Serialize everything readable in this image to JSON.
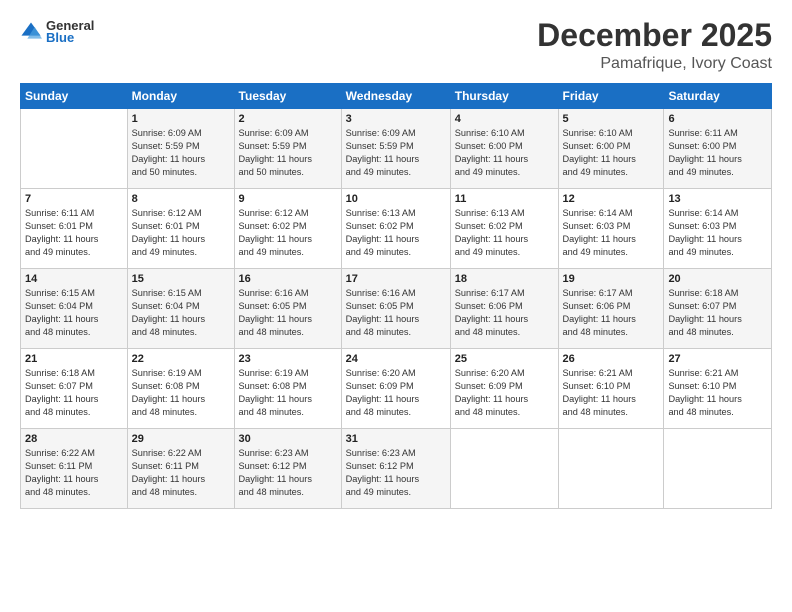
{
  "logo": {
    "text_general": "General",
    "text_blue": "Blue"
  },
  "header": {
    "month": "December 2025",
    "location": "Pamafrique, Ivory Coast"
  },
  "weekdays": [
    "Sunday",
    "Monday",
    "Tuesday",
    "Wednesday",
    "Thursday",
    "Friday",
    "Saturday"
  ],
  "weeks": [
    [
      {
        "day": "",
        "info": ""
      },
      {
        "day": "1",
        "info": "Sunrise: 6:09 AM\nSunset: 5:59 PM\nDaylight: 11 hours\nand 50 minutes."
      },
      {
        "day": "2",
        "info": "Sunrise: 6:09 AM\nSunset: 5:59 PM\nDaylight: 11 hours\nand 50 minutes."
      },
      {
        "day": "3",
        "info": "Sunrise: 6:09 AM\nSunset: 5:59 PM\nDaylight: 11 hours\nand 49 minutes."
      },
      {
        "day": "4",
        "info": "Sunrise: 6:10 AM\nSunset: 6:00 PM\nDaylight: 11 hours\nand 49 minutes."
      },
      {
        "day": "5",
        "info": "Sunrise: 6:10 AM\nSunset: 6:00 PM\nDaylight: 11 hours\nand 49 minutes."
      },
      {
        "day": "6",
        "info": "Sunrise: 6:11 AM\nSunset: 6:00 PM\nDaylight: 11 hours\nand 49 minutes."
      }
    ],
    [
      {
        "day": "7",
        "info": "Sunrise: 6:11 AM\nSunset: 6:01 PM\nDaylight: 11 hours\nand 49 minutes."
      },
      {
        "day": "8",
        "info": "Sunrise: 6:12 AM\nSunset: 6:01 PM\nDaylight: 11 hours\nand 49 minutes."
      },
      {
        "day": "9",
        "info": "Sunrise: 6:12 AM\nSunset: 6:02 PM\nDaylight: 11 hours\nand 49 minutes."
      },
      {
        "day": "10",
        "info": "Sunrise: 6:13 AM\nSunset: 6:02 PM\nDaylight: 11 hours\nand 49 minutes."
      },
      {
        "day": "11",
        "info": "Sunrise: 6:13 AM\nSunset: 6:02 PM\nDaylight: 11 hours\nand 49 minutes."
      },
      {
        "day": "12",
        "info": "Sunrise: 6:14 AM\nSunset: 6:03 PM\nDaylight: 11 hours\nand 49 minutes."
      },
      {
        "day": "13",
        "info": "Sunrise: 6:14 AM\nSunset: 6:03 PM\nDaylight: 11 hours\nand 49 minutes."
      }
    ],
    [
      {
        "day": "14",
        "info": "Sunrise: 6:15 AM\nSunset: 6:04 PM\nDaylight: 11 hours\nand 48 minutes."
      },
      {
        "day": "15",
        "info": "Sunrise: 6:15 AM\nSunset: 6:04 PM\nDaylight: 11 hours\nand 48 minutes."
      },
      {
        "day": "16",
        "info": "Sunrise: 6:16 AM\nSunset: 6:05 PM\nDaylight: 11 hours\nand 48 minutes."
      },
      {
        "day": "17",
        "info": "Sunrise: 6:16 AM\nSunset: 6:05 PM\nDaylight: 11 hours\nand 48 minutes."
      },
      {
        "day": "18",
        "info": "Sunrise: 6:17 AM\nSunset: 6:06 PM\nDaylight: 11 hours\nand 48 minutes."
      },
      {
        "day": "19",
        "info": "Sunrise: 6:17 AM\nSunset: 6:06 PM\nDaylight: 11 hours\nand 48 minutes."
      },
      {
        "day": "20",
        "info": "Sunrise: 6:18 AM\nSunset: 6:07 PM\nDaylight: 11 hours\nand 48 minutes."
      }
    ],
    [
      {
        "day": "21",
        "info": "Sunrise: 6:18 AM\nSunset: 6:07 PM\nDaylight: 11 hours\nand 48 minutes."
      },
      {
        "day": "22",
        "info": "Sunrise: 6:19 AM\nSunset: 6:08 PM\nDaylight: 11 hours\nand 48 minutes."
      },
      {
        "day": "23",
        "info": "Sunrise: 6:19 AM\nSunset: 6:08 PM\nDaylight: 11 hours\nand 48 minutes."
      },
      {
        "day": "24",
        "info": "Sunrise: 6:20 AM\nSunset: 6:09 PM\nDaylight: 11 hours\nand 48 minutes."
      },
      {
        "day": "25",
        "info": "Sunrise: 6:20 AM\nSunset: 6:09 PM\nDaylight: 11 hours\nand 48 minutes."
      },
      {
        "day": "26",
        "info": "Sunrise: 6:21 AM\nSunset: 6:10 PM\nDaylight: 11 hours\nand 48 minutes."
      },
      {
        "day": "27",
        "info": "Sunrise: 6:21 AM\nSunset: 6:10 PM\nDaylight: 11 hours\nand 48 minutes."
      }
    ],
    [
      {
        "day": "28",
        "info": "Sunrise: 6:22 AM\nSunset: 6:11 PM\nDaylight: 11 hours\nand 48 minutes."
      },
      {
        "day": "29",
        "info": "Sunrise: 6:22 AM\nSunset: 6:11 PM\nDaylight: 11 hours\nand 48 minutes."
      },
      {
        "day": "30",
        "info": "Sunrise: 6:23 AM\nSunset: 6:12 PM\nDaylight: 11 hours\nand 48 minutes."
      },
      {
        "day": "31",
        "info": "Sunrise: 6:23 AM\nSunset: 6:12 PM\nDaylight: 11 hours\nand 49 minutes."
      },
      {
        "day": "",
        "info": ""
      },
      {
        "day": "",
        "info": ""
      },
      {
        "day": "",
        "info": ""
      }
    ]
  ]
}
